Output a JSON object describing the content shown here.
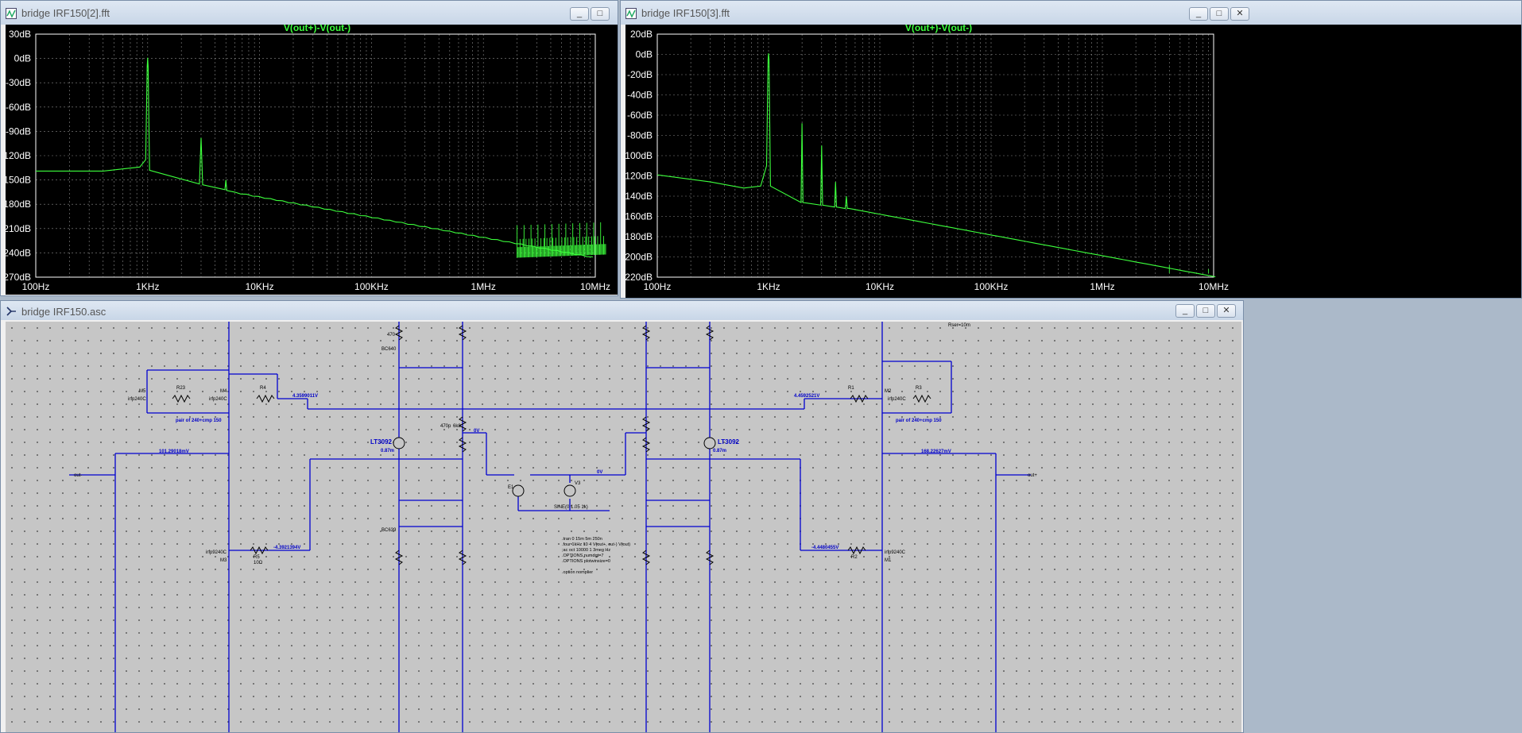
{
  "fft1": {
    "title": "bridge IRF150[2].fft",
    "trace_label": "V(out+)-V(out-)",
    "y_ticks": [
      "30dB",
      "0dB",
      "-30dB",
      "-60dB",
      "-90dB",
      "-120dB",
      "-150dB",
      "-180dB",
      "-210dB",
      "-240dB",
      "-270dB"
    ],
    "x_ticks": [
      "100Hz",
      "1KHz",
      "10KHz",
      "100KHz",
      "1MHz",
      "10MHz"
    ],
    "buttons": {
      "minimize": "_",
      "maximize": "□",
      "close": "✕"
    }
  },
  "fft2": {
    "title": "bridge IRF150[3].fft",
    "trace_label": "V(out+)-V(out-)",
    "y_ticks": [
      "20dB",
      "0dB",
      "-20dB",
      "-40dB",
      "-60dB",
      "-80dB",
      "-100dB",
      "-120dB",
      "-140dB",
      "-160dB",
      "-180dB",
      "-200dB",
      "-220dB"
    ],
    "x_ticks": [
      "100Hz",
      "1KHz",
      "10KHz",
      "100KHz",
      "1MHz",
      "10MHz"
    ],
    "buttons": {
      "minimize": "_",
      "maximize": "□",
      "close": "✕"
    }
  },
  "schematic": {
    "title": "bridge IRF150.asc",
    "buttons": {
      "minimize": "_",
      "maximize": "□",
      "close": "✕"
    },
    "labels": {
      "out_minus": "out-",
      "out_plus": "out+",
      "v_left_top": "4.3599011V",
      "v_right_top": "4.4592521V",
      "v_left_mid": "101.29018mV",
      "v_right_mid": "168.22627mV",
      "v_left_bot": "-4.3921394V",
      "v_right_bot": "-4.4480455V",
      "zero_v_1": "0V",
      "zero_v_2": "0V",
      "pair_left": "pair of 240+cmp 150",
      "pair_right": "pair of 240+cmp 150",
      "lt3092_left": "LT3092",
      "lt3092_right": "LT3092",
      "i_left": "0.87m",
      "i_right": "0.87m",
      "sine": "SINE(0 1.05 1k)",
      "rser": "Rser=10m",
      "m5": "M5",
      "m4": "M4",
      "m3": "M3",
      "m1": "M1",
      "m2": "M2",
      "irfp240c_1": "irfp240C",
      "irfp240c_2": "irfp240C",
      "irfp240c_3": "irfp240C",
      "irfp9240c_1": "irfp9240C",
      "irfp9240c_2": "irfp9240C",
      "r23": "R23",
      "r4": "R4",
      "r5": "R5",
      "r1": "R1",
      "r3": "R3",
      "r2": "R2",
      "v100": "100",
      "v10": "10Ω",
      "bc640": "BC640",
      "bc639": "BC639",
      "c470p": "470p",
      "c6k8": "6k8",
      "r470": "470",
      "e1": "E1",
      "v3": "V3"
    },
    "directives": [
      ".tran 0 15m 5m 250n",
      ".four 1kHz 10 4 V(out+, out-) V(out)",
      ";ac oct 10000 1 3meg Hz",
      ".OPTIONS numdgt=7",
      ".OPTIONS plotwinsize=0",
      "",
      ".option nomplier"
    ]
  }
}
